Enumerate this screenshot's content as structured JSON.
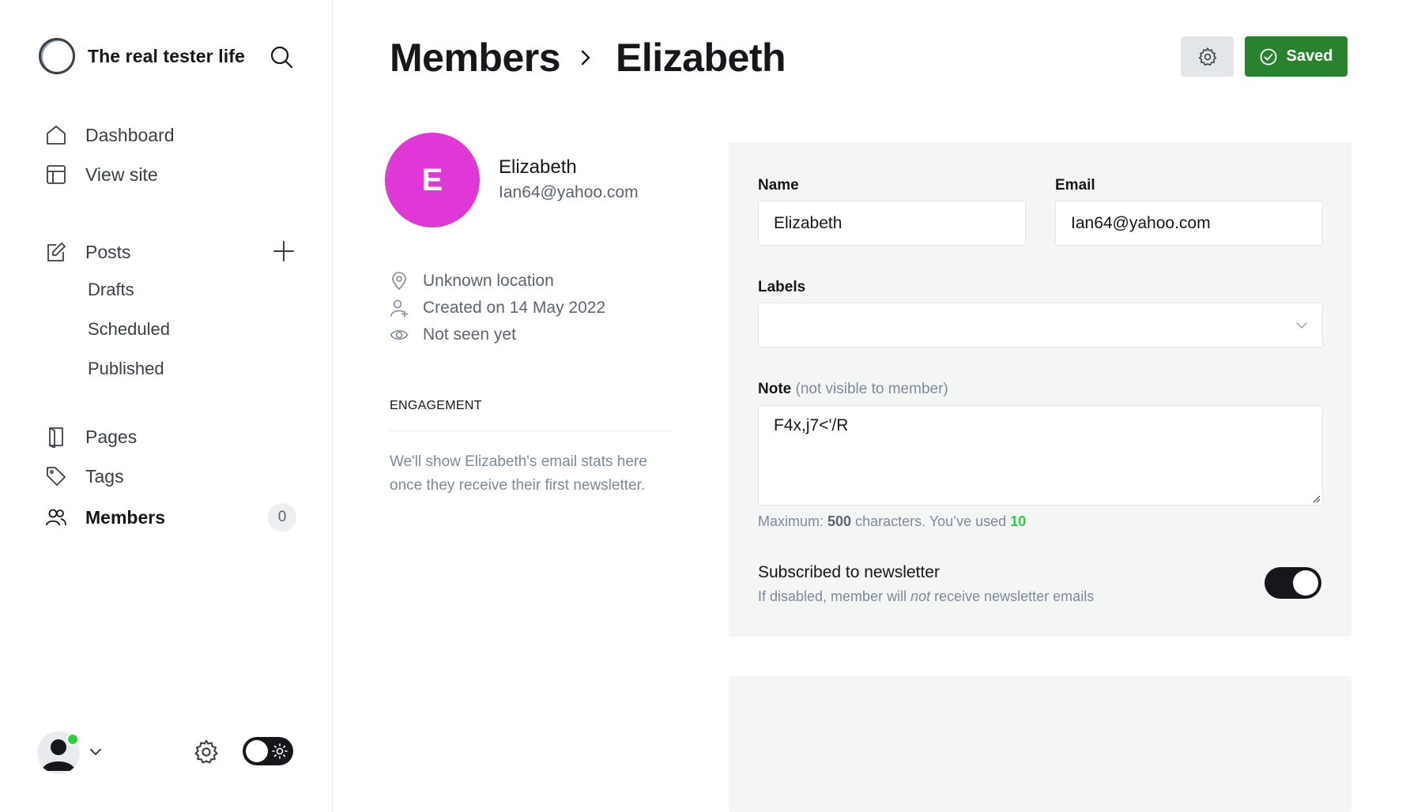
{
  "sidebar": {
    "site_title": "The real tester life",
    "nav": {
      "dashboard": "Dashboard",
      "view_site": "View site",
      "posts": "Posts",
      "drafts": "Drafts",
      "scheduled": "Scheduled",
      "published": "Published",
      "pages": "Pages",
      "tags": "Tags",
      "members": "Members",
      "members_count": "0"
    }
  },
  "header": {
    "breadcrumb_parent": "Members",
    "breadcrumb_current": "Elizabeth",
    "saved_label": "Saved"
  },
  "member": {
    "initial": "E",
    "name": "Elizabeth",
    "email": "Ian64@yahoo.com",
    "location": "Unknown location",
    "created": "Created on 14 May 2022",
    "last_seen": "Not seen yet",
    "avatar_color": "#e037d7"
  },
  "engagement": {
    "title": "ENGAGEMENT",
    "text": "We'll show Elizabeth's email stats here once they receive their first newsletter."
  },
  "form": {
    "name_label": "Name",
    "name_value": "Elizabeth",
    "email_label": "Email",
    "email_value": "Ian64@yahoo.com",
    "labels_label": "Labels",
    "labels_value": "",
    "note_label": "Note",
    "note_muted": "(not visible to member)",
    "note_value": "F4x,j7<'/R",
    "hint_prefix": "Maximum: ",
    "hint_max": "500",
    "hint_middle": " characters. You’ve used ",
    "hint_used": "10",
    "newsletter_title": "Subscribed to newsletter",
    "newsletter_desc_prefix": "If disabled, member will ",
    "newsletter_desc_em": "not",
    "newsletter_desc_suffix": " receive newsletter emails",
    "newsletter_subscribed": true
  },
  "colors": {
    "accent_green": "#29832e",
    "used_count_green": "#30cf43",
    "status_online": "#30cf43"
  }
}
